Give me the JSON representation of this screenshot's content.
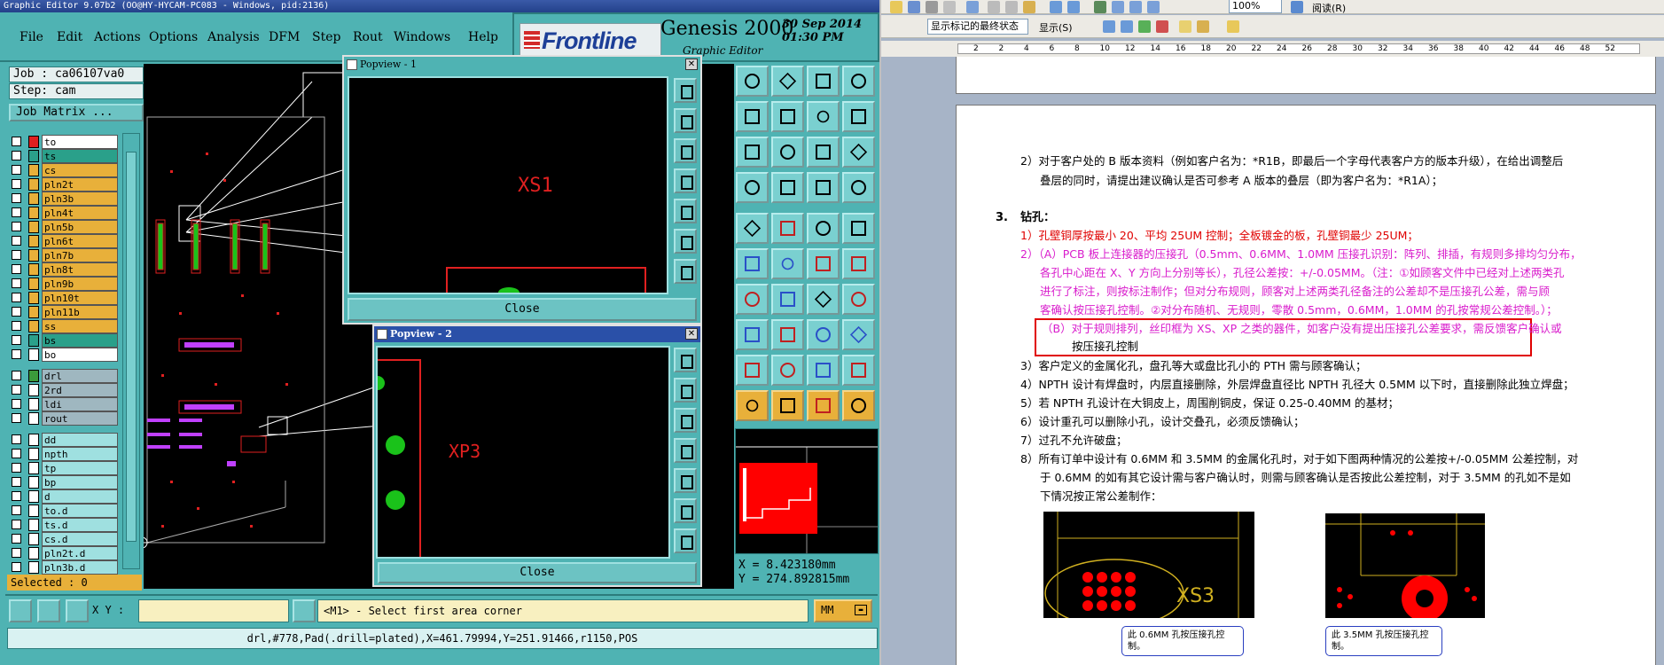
{
  "genesis": {
    "title_bar": "Graphic Editor 9.07b2 (OO@HY-HYCAM-PC083 - Windows, pid:2136)",
    "menu": [
      "File",
      "Edit",
      "Actions",
      "Options",
      "Analysis",
      "DFM",
      "Step",
      "Rout",
      "Windows",
      "Help"
    ],
    "brand": {
      "logo": "Frontline",
      "product": "Genesis 2000",
      "subtitle": "Graphic Editor",
      "date": "30 Sep 2014\n01:30 PM"
    },
    "job": {
      "job_line": "Job : ca06107va0",
      "step_line": "Step: cam",
      "matrix_button": "Job Matrix ..."
    },
    "layers": [
      {
        "name": "to",
        "color": "#ffffff",
        "swatch": "#e02020"
      },
      {
        "name": "ts",
        "color": "#2aa08a",
        "swatch": "#2aa08a"
      },
      {
        "name": "cs",
        "color": "#e8b03a",
        "swatch": "#e8b03a"
      },
      {
        "name": "pln2t",
        "color": "#e8b03a",
        "swatch": "#e8b03a"
      },
      {
        "name": "pln3b",
        "color": "#e8b03a",
        "swatch": "#e8b03a"
      },
      {
        "name": "pln4t",
        "color": "#e8b03a",
        "swatch": "#e8b03a"
      },
      {
        "name": "pln5b",
        "color": "#e8b03a",
        "swatch": "#e8b03a"
      },
      {
        "name": "pln6t",
        "color": "#e8b03a",
        "swatch": "#e8b03a"
      },
      {
        "name": "pln7b",
        "color": "#e8b03a",
        "swatch": "#e8b03a"
      },
      {
        "name": "pln8t",
        "color": "#e8b03a",
        "swatch": "#e8b03a"
      },
      {
        "name": "pln9b",
        "color": "#e8b03a",
        "swatch": "#e8b03a"
      },
      {
        "name": "pln10t",
        "color": "#e8b03a",
        "swatch": "#e8b03a"
      },
      {
        "name": "pln11b",
        "color": "#e8b03a",
        "swatch": "#e8b03a"
      },
      {
        "name": "ss",
        "color": "#e8b03a",
        "swatch": "#e8b03a"
      },
      {
        "name": "bs",
        "color": "#2aa08a",
        "swatch": "#2aa08a"
      },
      {
        "name": "bo",
        "color": "#ffffff",
        "swatch": "#ffffff"
      },
      {
        "name": "drl",
        "color": "#9fb7c0",
        "swatch": "#3b9a3b"
      },
      {
        "name": "2rd",
        "color": "#9fb7c0",
        "swatch": "#ffffff"
      },
      {
        "name": "ldi",
        "color": "#9fb7c0",
        "swatch": "#ffffff"
      },
      {
        "name": "rout",
        "color": "#9fb7c0",
        "swatch": "#ffffff"
      },
      {
        "name": "dd",
        "color": "#9fe0e0",
        "swatch": "#ffffff"
      },
      {
        "name": "npth",
        "color": "#9fe0e0",
        "swatch": "#ffffff"
      },
      {
        "name": "tp",
        "color": "#9fe0e0",
        "swatch": "#ffffff"
      },
      {
        "name": "bp",
        "color": "#9fe0e0",
        "swatch": "#ffffff"
      },
      {
        "name": "d",
        "color": "#9fe0e0",
        "swatch": "#ffffff"
      },
      {
        "name": "to.d",
        "color": "#9fe0e0",
        "swatch": "#ffffff"
      },
      {
        "name": "ts.d",
        "color": "#9fe0e0",
        "swatch": "#ffffff"
      },
      {
        "name": "cs.d",
        "color": "#9fe0e0",
        "swatch": "#ffffff"
      },
      {
        "name": "pln2t.d",
        "color": "#9fe0e0",
        "swatch": "#ffffff"
      },
      {
        "name": "pln3b.d",
        "color": "#9fe0e0",
        "swatch": "#ffffff"
      }
    ],
    "selected": "Selected : 0",
    "popview1": {
      "title": "Popview - 1",
      "label": "XS1",
      "close": "Close"
    },
    "popview2": {
      "title": "Popview - 2",
      "label": "XP3",
      "close": "Close"
    },
    "coords": "X = 8.423180mm\nY = 274.892815mm",
    "status": {
      "xy_label": "X Y :",
      "xy_value": "",
      "prompt": "<M1> - Select first area corner",
      "units": "MM"
    },
    "info_line": "drl,#778,Pad(.drill=plated),X=461.79994,Y=251.91466,r1150,POS"
  },
  "word": {
    "toolbar": {
      "view_dropdown": "显示标记的最终状态",
      "show_dropdown": "显示(S)",
      "zoom": "100%",
      "read_button": "阅读(R)"
    },
    "ruler": [
      "2",
      "2",
      "4",
      "6",
      "8",
      "10",
      "12",
      "14",
      "16",
      "18",
      "20",
      "22",
      "24",
      "26",
      "28",
      "30",
      "32",
      "34",
      "36",
      "38",
      "40",
      "42",
      "44",
      "46",
      "48",
      "52"
    ],
    "doc": {
      "p_b_version_1": "2）对于客户处的 B 版本资料（例如客户名为：*R1B，即最后一个字母代表客户方的版本升级），在给出调整后",
      "p_b_version_2": "叠层的同时，请提出建议确认是否可参考 A 版本的叠层（即为客户名为：*R1A）；",
      "heading_num": "3.",
      "heading": "钻孔：",
      "i1": "1）孔壁铜厚按最小 20、平均 25UM 控制；全板镀金的板，孔壁铜最少 25UM；",
      "i2_1": "2）（A）PCB 板上连接器的压接孔（0.5mm、0.6MM、1.0MM 压接孔识别：阵列、排插，有规则多排均匀分布，",
      "i2_2": "各孔中心距在 X、Y 方向上分别等长），孔径公差按：+/-0.05MM。（注：①如顾客文件中已经对上述两类孔",
      "i2_3": "进行了标注，则按标注制作；但对分布规则，顾客对上述两类孔径备注的公差却不是压接孔公差，需与顾",
      "i2_4": "客确认按压接孔控制。②对分布随机、无规则，零散 0.5mm，0.6MM，1.0MM 的孔按常规公差控制。）；",
      "i2b_1": "（B）对于规则排列，丝印框为 XS、XP 之类的器件，如客户没有提出压接孔公差要求，需反馈客户确认或",
      "i2b_2": "按压接孔控制",
      "i3": "3）客户定义的金属化孔，盘孔等大或盘比孔小的 PTH 需与顾客确认；",
      "i4": "4）NPTH 设计有焊盘时，内层直接删除，外层焊盘直径比 NPTH 孔径大 0.5MM 以下时，直接删除此独立焊盘；",
      "i5": "5）若 NPTH 孔设计在大铜皮上，周围削铜皮，保证 0.25-0.40MM 的基材；",
      "i6": "6）设计重孔可以删除小孔，设计交叠孔，必须反馈确认；",
      "i7": "7）过孔不允许破盘；",
      "i8_1": "8）所有订单中设计有 0.6MM 和 3.5MM 的金属化孔时，对于如下图两种情况的公差按+/-0.05MM 公差控制，对",
      "i8_2": "于 0.6MM 的如有其它设计需与客户确认时，则需与顾客确认是否按此公差控制，对于 3.5MM 的孔如不是如",
      "i8_3": "下情况按正常公差制作：",
      "img1_label": "XS3",
      "callout1": "此 0.6MM 孔按压接孔控制。",
      "callout2": "此 3.5MM 孔按压接孔控制。"
    }
  }
}
